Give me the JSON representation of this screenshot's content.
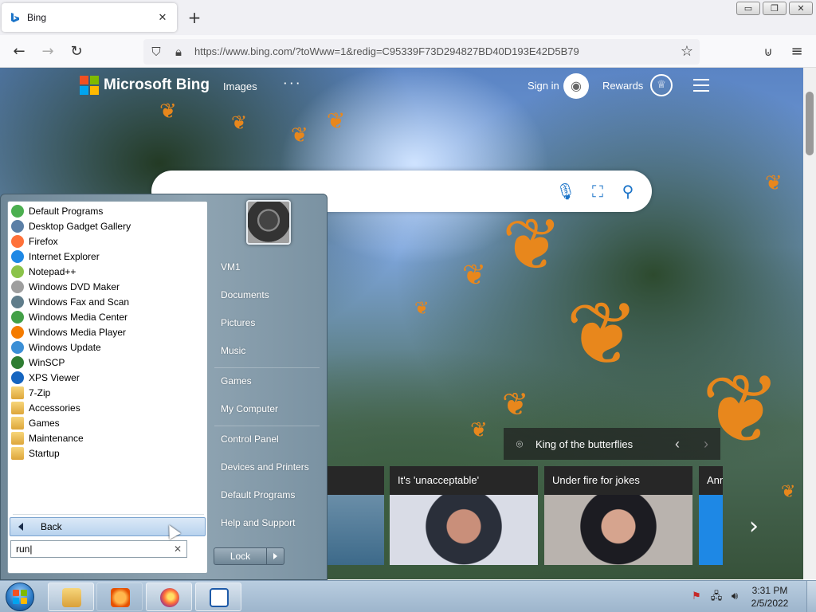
{
  "browser": {
    "tab_title": "Bing",
    "tab_close": "✕",
    "new_tab": "+",
    "url": "https://www.bing.com/?toWww=1&redig=C95339F73D294827BD40D193E42D5B79",
    "window_buttons": [
      "▭",
      "❐",
      "✕"
    ]
  },
  "bing": {
    "brand": "Microsoft Bing",
    "nav_images": "Images",
    "nav_more": "· · ·",
    "signin": "Sign in",
    "rewards": "Rewards",
    "caption": "King of the butterflies",
    "news": [
      {
        "title": "It's 'unacceptable'"
      },
      {
        "title": "Under fire for jokes"
      },
      {
        "title": "Ann"
      }
    ],
    "colors": {
      "ms_red": "#f25022",
      "ms_green": "#7fba00",
      "ms_blue": "#00a4ef",
      "ms_yellow": "#ffb900",
      "accent": "#1a73c8"
    }
  },
  "start_menu": {
    "programs": [
      {
        "label": "Default Programs",
        "icon": "default-programs-icon",
        "color": "#4caf50"
      },
      {
        "label": "Desktop Gadget Gallery",
        "icon": "gadget-icon",
        "color": "#5b7fa6"
      },
      {
        "label": "Firefox",
        "icon": "firefox-icon",
        "color": "#ff7139"
      },
      {
        "label": "Internet Explorer",
        "icon": "ie-icon",
        "color": "#1e88e5"
      },
      {
        "label": "Notepad++",
        "icon": "notepadpp-icon",
        "color": "#8bc34a"
      },
      {
        "label": "Windows DVD Maker",
        "icon": "dvd-maker-icon",
        "color": "#9e9e9e"
      },
      {
        "label": "Windows Fax and Scan",
        "icon": "fax-scan-icon",
        "color": "#607d8b"
      },
      {
        "label": "Windows Media Center",
        "icon": "media-center-icon",
        "color": "#43a047"
      },
      {
        "label": "Windows Media Player",
        "icon": "media-player-icon",
        "color": "#f57c00"
      },
      {
        "label": "Windows Update",
        "icon": "windows-update-icon",
        "color": "#3b8fd6"
      },
      {
        "label": "WinSCP",
        "icon": "winscp-icon",
        "color": "#2e7d32"
      },
      {
        "label": "XPS Viewer",
        "icon": "xps-viewer-icon",
        "color": "#1565c0"
      },
      {
        "label": "7-Zip",
        "icon": "folder-icon",
        "color": "folder"
      },
      {
        "label": "Accessories",
        "icon": "folder-icon",
        "color": "folder"
      },
      {
        "label": "Games",
        "icon": "folder-icon",
        "color": "folder"
      },
      {
        "label": "Maintenance",
        "icon": "folder-icon",
        "color": "folder"
      },
      {
        "label": "Startup",
        "icon": "folder-icon",
        "color": "folder"
      }
    ],
    "back_label": "Back",
    "search_value": "run",
    "search_clear": "✕",
    "right_links": [
      "VM1",
      "Documents",
      "Pictures",
      "Music",
      "Games",
      "My Computer",
      "Control Panel",
      "Devices and Printers",
      "Default Programs",
      "Help and Support"
    ],
    "lock_label": "Lock"
  },
  "taskbar": {
    "clock_time": "3:31 PM",
    "clock_date": "2/5/2022"
  }
}
